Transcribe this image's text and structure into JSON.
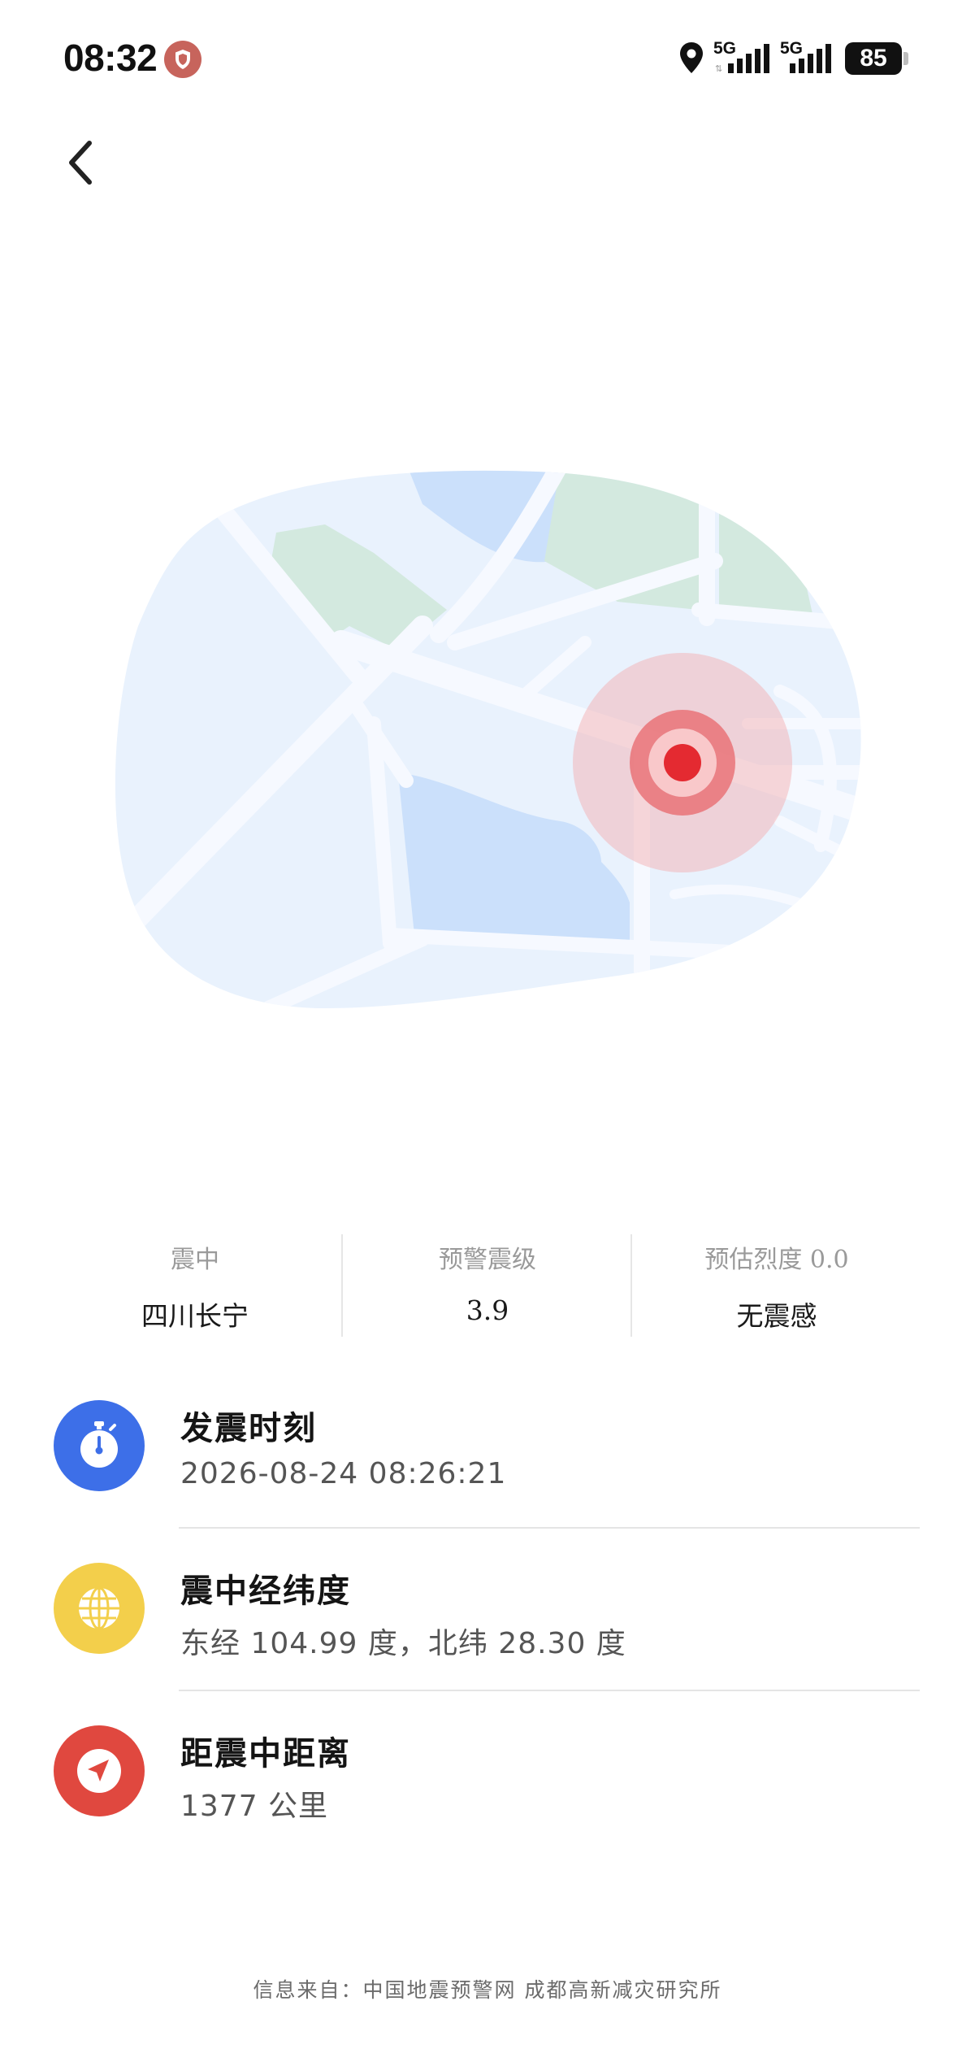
{
  "status_bar": {
    "time": "08:32",
    "network_1": "5G",
    "network_2": "5G",
    "battery": "85"
  },
  "stats": [
    {
      "label": "震中",
      "value": "四川长宁"
    },
    {
      "label": "预警震级",
      "value": "3.9"
    },
    {
      "label": "预估烈度 0.0",
      "value": "无震感"
    }
  ],
  "info": {
    "time": {
      "title": "发震时刻",
      "value": "2026-08-24 08:26:21",
      "icon": "stopwatch-icon",
      "color": "#3d6fe8"
    },
    "coords": {
      "title": "震中经纬度",
      "value": "东经 104.99 度，北纬 28.30 度",
      "icon": "globe-icon",
      "color": "#f3cf4b"
    },
    "distance": {
      "title": "距震中距离",
      "value": "1377 公里",
      "icon": "navigation-arrow-icon",
      "color": "#e0483f"
    }
  },
  "footer": "信息来自：中国地震预警网 成都高新减灾研究所"
}
